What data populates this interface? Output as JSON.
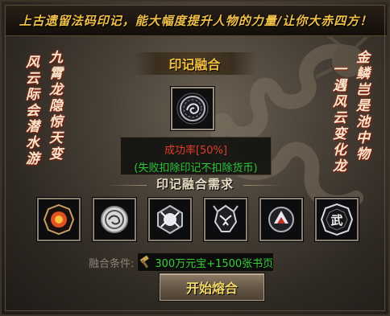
{
  "banner": {
    "text": "上古遗留法码印记，能大幅度提升人物的力量/让你大赤四方！"
  },
  "panel": {
    "title": "印记融合"
  },
  "left_poems": {
    "outer": "风云际会潜水游",
    "inner": "九霄龙隐惊天变"
  },
  "right_poems": {
    "outer": "金鳞岂是池中物",
    "inner": "一遇风云变化龙"
  },
  "fusion": {
    "success_rate": "成功率[50%]",
    "failure_note": "(失败扣除印记不扣除货币)"
  },
  "requirements": {
    "title": "印记融合需求"
  },
  "materials": [
    {
      "icon": "fire-bagua-seal-icon"
    },
    {
      "icon": "dragon-coin-seal-icon"
    },
    {
      "icon": "dragon-emblem-seal-icon"
    },
    {
      "icon": "dragon-head-seal-icon"
    },
    {
      "icon": "flame-emblem-seal-icon"
    },
    {
      "icon": "wu-bagua-seal-icon",
      "char": "武"
    }
  ],
  "condition": {
    "label": "融合条件:",
    "cost": "300万元宝+1500张书页",
    "icon": "hammer-icon"
  },
  "start_button": {
    "label": "开始熔合"
  },
  "colors": {
    "gold": "#f4c040",
    "success_red": "#e03c2c",
    "note_green": "#28c838",
    "cost_green": "#38d038"
  }
}
